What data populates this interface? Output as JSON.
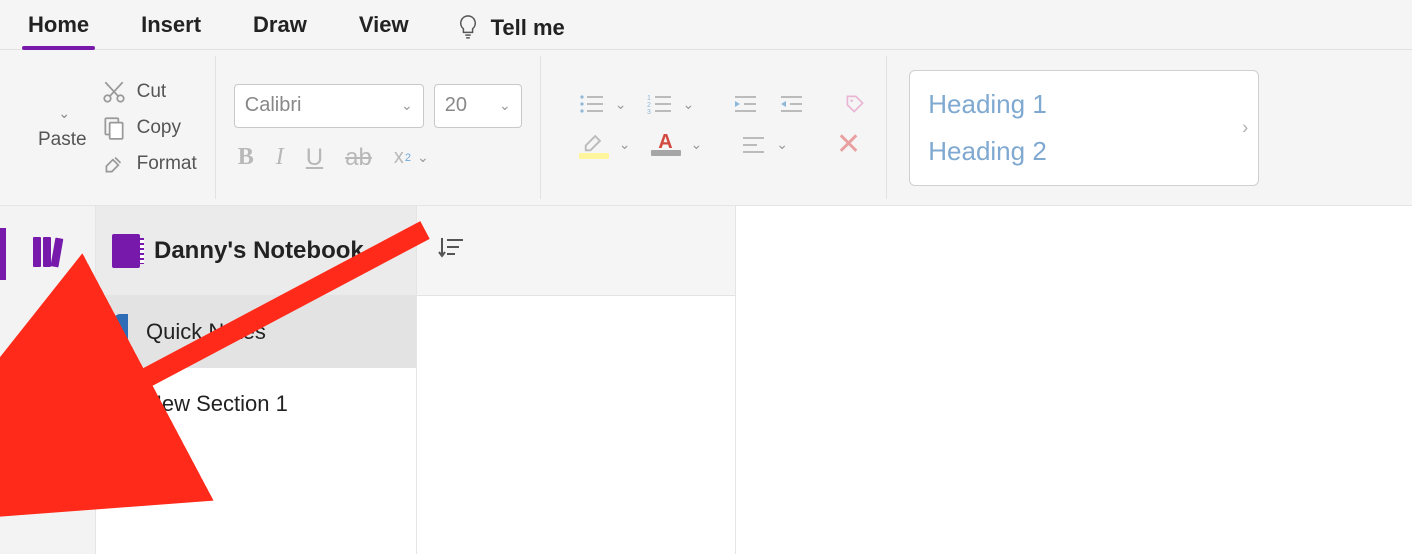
{
  "menu": {
    "tabs": [
      "Home",
      "Insert",
      "Draw",
      "View"
    ],
    "active": "Home",
    "tellme": "Tell me"
  },
  "ribbon": {
    "paste_label": "Paste",
    "cut_label": "Cut",
    "copy_label": "Copy",
    "format_label": "Format",
    "font_name": "Calibri",
    "font_size": "20",
    "styles": {
      "heading1": "Heading 1",
      "heading2": "Heading 2"
    }
  },
  "sidebar": {
    "notebook_title": "Danny's Notebook",
    "sections": [
      {
        "label": "Quick Notes",
        "selected": true
      },
      {
        "label": "New Section 1",
        "selected": false
      }
    ]
  }
}
